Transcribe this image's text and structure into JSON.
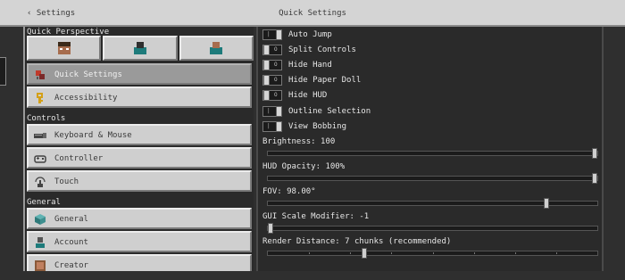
{
  "header": {
    "back_label": "‹ Settings",
    "title": "Quick Settings"
  },
  "sidebar": {
    "quick_perspective_label": "Quick Perspective",
    "perspectives": [
      {
        "name": "first-person-icon"
      },
      {
        "name": "third-person-back-icon"
      },
      {
        "name": "third-person-front-icon"
      }
    ],
    "items": [
      {
        "label": "Quick Settings",
        "icon": "quick-settings-icon",
        "selected": true
      },
      {
        "label": "Accessibility",
        "icon": "key-icon"
      }
    ],
    "controls_label": "Controls",
    "controls_items": [
      {
        "label": "Keyboard & Mouse",
        "icon": "keyboard-mouse-icon"
      },
      {
        "label": "Controller",
        "icon": "controller-icon"
      },
      {
        "label": "Touch",
        "icon": "touch-icon"
      }
    ],
    "general_label": "General",
    "general_items": [
      {
        "label": "General",
        "icon": "cube-icon"
      },
      {
        "label": "Account",
        "icon": "account-icon"
      },
      {
        "label": "Creator",
        "icon": "creator-icon"
      }
    ]
  },
  "toggles": [
    {
      "label": "Auto Jump",
      "on": true
    },
    {
      "label": "Split Controls",
      "on": false
    },
    {
      "label": "Hide Hand",
      "on": false
    },
    {
      "label": "Hide Paper Doll",
      "on": false
    },
    {
      "label": "Hide HUD",
      "on": false
    },
    {
      "label": "Outline Selection",
      "on": true
    },
    {
      "label": "View Bobbing",
      "on": true
    }
  ],
  "sliders": [
    {
      "label": "Brightness: 100",
      "value_fraction": 1.0
    },
    {
      "label": "HUD Opacity: 100%",
      "value_fraction": 1.0
    },
    {
      "label": "FOV: 98.00°",
      "value_fraction": 0.85
    },
    {
      "label": "GUI Scale Modifier: -1",
      "value_fraction": 0.0
    },
    {
      "label": "Render Distance: 7 chunks (recommended)",
      "value_fraction": 0.29,
      "ticks": 8
    }
  ],
  "colors": {
    "header_bg": "#d4d4d4",
    "panel_bg": "#2a2a2a",
    "button_bg": "#cfcfcf",
    "selected_bg": "#9a9a9a"
  }
}
